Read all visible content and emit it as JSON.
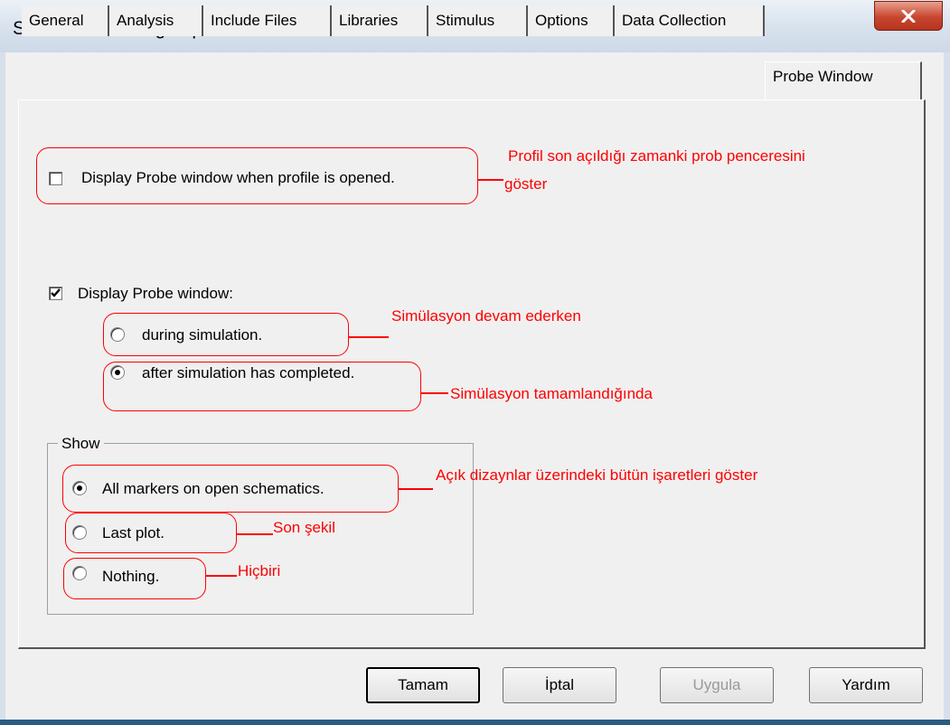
{
  "window": {
    "title": "Simulation Settings - pamukkale",
    "close_label": "X"
  },
  "tabs": [
    {
      "label": "General"
    },
    {
      "label": "Analysis"
    },
    {
      "label": "Include Files"
    },
    {
      "label": "Libraries"
    },
    {
      "label": "Stimulus"
    },
    {
      "label": "Options"
    },
    {
      "label": "Data Collection"
    },
    {
      "label": "Probe Window"
    }
  ],
  "active_tab": "Probe Window",
  "options": {
    "display_on_open": {
      "label": "Display Probe window when profile is opened.",
      "checked": false
    },
    "display_probe": {
      "label": "Display Probe window:",
      "checked": true
    },
    "during_sim": {
      "label": "during simulation.",
      "selected": false
    },
    "after_sim": {
      "label": "after simulation has completed.",
      "selected": true
    }
  },
  "show_group": {
    "label": "Show",
    "all_markers": {
      "label": "All markers on open schematics.",
      "selected": true
    },
    "last_plot": {
      "label": "Last plot.",
      "selected": false
    },
    "nothing": {
      "label": "Nothing.",
      "selected": false
    }
  },
  "annotations": {
    "profile_line1": "Profil son açıldığı zamanki prob penceresini",
    "profile_line2": "göster",
    "during": "Simülasyon devam ederken",
    "after": "Simülasyon tamamlandığında",
    "all_markers": "Açık dizaynlar üzerindeki bütün işaretleri göster",
    "last_plot": "Son şekil",
    "nothing": "Hiçbiri"
  },
  "buttons": {
    "ok": "Tamam",
    "cancel": "İptal",
    "apply": "Uygula",
    "help": "Yardım"
  },
  "colors": {
    "annotation": "#ff0000",
    "titlebar": "#d9e3ee",
    "dialog_bg": "#f0f0f0"
  }
}
